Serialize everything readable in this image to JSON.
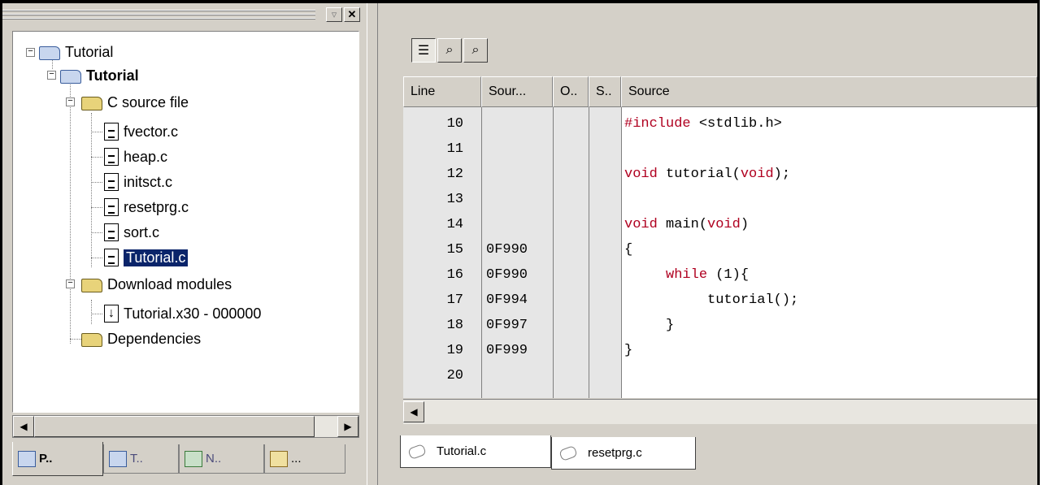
{
  "tree": {
    "root_label": "Tutorial",
    "project_label": "Tutorial",
    "folders": {
      "c_source": "C source file",
      "download": "Download modules",
      "dependencies": "Dependencies"
    },
    "files": [
      "fvector.c",
      "heap.c",
      "initsct.c",
      "resetprg.c",
      "sort.c",
      "Tutorial.c"
    ],
    "selected_file": "Tutorial.c",
    "download_module": "Tutorial.x30 - 000000"
  },
  "pane_controls": {
    "pin": "▿",
    "close": "✕"
  },
  "bottom_tabs": [
    {
      "label": "P..",
      "icon": "projects-icon"
    },
    {
      "label": "T..",
      "icon": "templates-icon"
    },
    {
      "label": "N..",
      "icon": "navigation-icon"
    },
    {
      "label": "...",
      "icon": "tasks-icon"
    }
  ],
  "scroll": {
    "left": "◀",
    "right": "▶"
  },
  "toolbar": [
    "source-mode-icon",
    "disassembly-mode-icon",
    "mixed-mode-icon"
  ],
  "editor": {
    "columns": [
      "Line",
      "Sour...",
      "O..",
      "S..",
      "Source"
    ],
    "rows": [
      {
        "line": "10",
        "addr": "",
        "code_pre": "",
        "kw": "#include",
        "code_post": " <stdlib.h>"
      },
      {
        "line": "11",
        "addr": "",
        "code_pre": "",
        "kw": "",
        "code_post": ""
      },
      {
        "line": "12",
        "addr": "",
        "code_pre": "",
        "kw": "void",
        "code_post": " tutorial(",
        "kw2": "void",
        "code_end": ");"
      },
      {
        "line": "13",
        "addr": "",
        "code_pre": "",
        "kw": "",
        "code_post": ""
      },
      {
        "line": "14",
        "addr": "",
        "code_pre": "",
        "kw": "void",
        "code_post": " main(",
        "kw2": "void",
        "code_end": ")"
      },
      {
        "line": "15",
        "addr": "0F990",
        "code_pre": "{",
        "kw": "",
        "code_post": ""
      },
      {
        "line": "16",
        "addr": "0F990",
        "code_pre": "     ",
        "kw": "while",
        "code_post": " (1){"
      },
      {
        "line": "17",
        "addr": "0F994",
        "code_pre": "          tutorial();",
        "kw": "",
        "code_post": ""
      },
      {
        "line": "18",
        "addr": "0F997",
        "code_pre": "     }",
        "kw": "",
        "code_post": ""
      },
      {
        "line": "19",
        "addr": "0F999",
        "code_pre": "}",
        "kw": "",
        "code_post": ""
      },
      {
        "line": "20",
        "addr": "",
        "code_pre": "",
        "kw": "",
        "code_post": ""
      }
    ]
  },
  "file_tabs": [
    "Tutorial.c",
    "resetprg.c"
  ],
  "colors": {
    "keyword": "#b00020",
    "selection": "#0a246a",
    "chrome": "#d4d0c8"
  }
}
